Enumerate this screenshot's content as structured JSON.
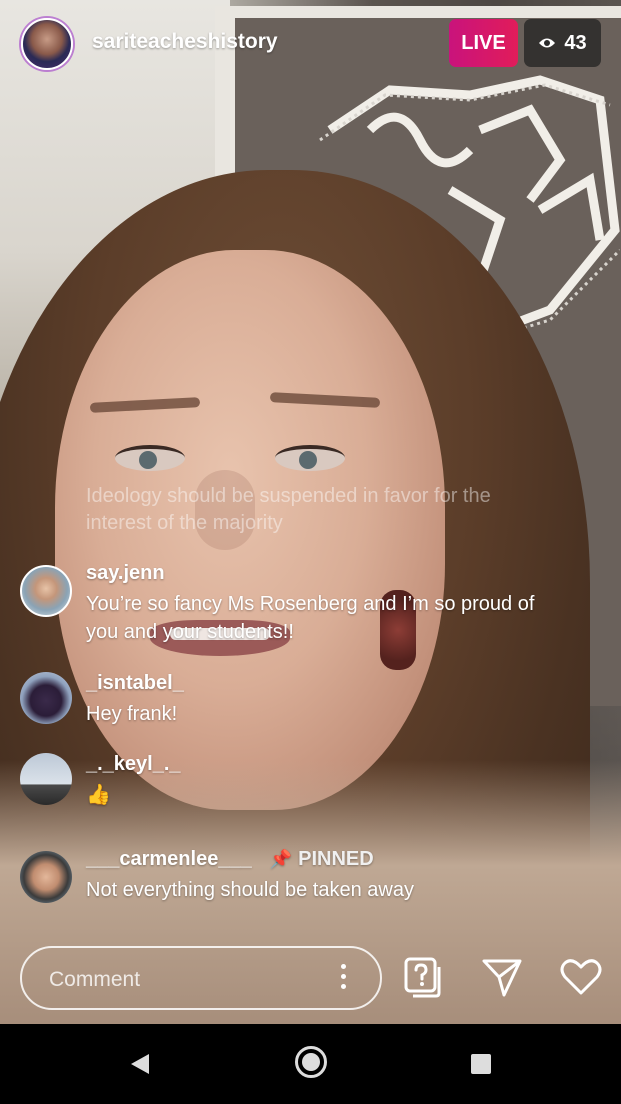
{
  "header": {
    "username": "sariteacheshistory",
    "live_label": "LIVE",
    "viewer_count": "43"
  },
  "faded_comment": {
    "text": "Ideology should be suspended in favor for the interest of the majority"
  },
  "comments": [
    {
      "username": "say.jenn",
      "text": "You’re so fancy Ms Rosenberg and I’m so proud of you and your students!!"
    },
    {
      "username": "_isntabel_",
      "text": "Hey frank!"
    },
    {
      "username": "_._keyl_._",
      "text": "👍"
    },
    {
      "username": "___carmenlee___",
      "pinned_label": "PINNED",
      "text": "Not everything should be taken away"
    }
  ],
  "composer": {
    "placeholder": "Comment"
  },
  "icons": {
    "question": "question-sticker-icon",
    "send": "send-icon",
    "like": "heart-icon"
  },
  "colors": {
    "live_gradient_start": "#c9137c",
    "live_gradient_end": "#e11c5a"
  }
}
